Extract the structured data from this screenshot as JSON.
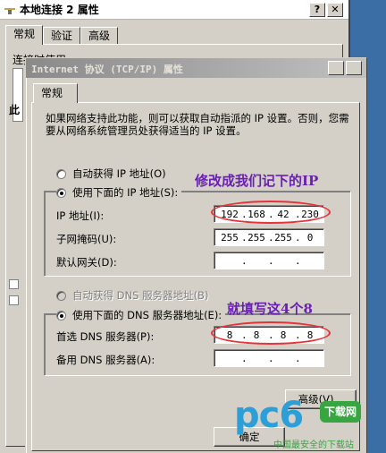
{
  "back_window": {
    "title": "本地连接 2 属性",
    "tabs": [
      "常规",
      "验证",
      "高级"
    ],
    "label": "连接时使用:",
    "glyph": "此",
    "help_btn": "?",
    "close_btn": "✕"
  },
  "dialog": {
    "title": "Internet 协议 (TCP/IP) 属性",
    "help_btn": "?",
    "close_btn": "✕",
    "tab": "常规",
    "description": "如果网络支持此功能，则可以获取自动指派的 IP 设置。否则，您需要从网络系统管理员处获得适当的 IP 设置。",
    "ip_auto_label": "自动获得 IP 地址(O)",
    "ip_manual_label": "使用下面的 IP 地址(S):",
    "ip_address_label": "IP 地址(I):",
    "ip_address": [
      "192",
      "168",
      "42",
      "230"
    ],
    "subnet_label": "子网掩码(U):",
    "subnet": [
      "255",
      "255",
      "255",
      "0"
    ],
    "gateway_label": "默认网关(D):",
    "gateway": [
      "",
      "",
      "",
      ""
    ],
    "dns_auto_label": "自动获得 DNS 服务器地址(B)",
    "dns_manual_label": "使用下面的 DNS 服务器地址(E):",
    "preferred_dns_label": "首选 DNS 服务器(P):",
    "preferred_dns": [
      "8",
      "8",
      "8",
      "8"
    ],
    "alternate_dns_label": "备用 DNS 服务器(A):",
    "alternate_dns": [
      "",
      "",
      "",
      ""
    ],
    "advanced_button": "高级(V)...",
    "ok_button": "确定"
  },
  "annotations": {
    "ip_note": "修改成我们记下的IP",
    "dns_note": "就填写这4个8",
    "color": "#6a1fb5",
    "ellipse_color": "#e8323a"
  },
  "watermark": {
    "brand": "pc6",
    "badge": "下载网",
    "sub": "中国最安全的下载站"
  }
}
